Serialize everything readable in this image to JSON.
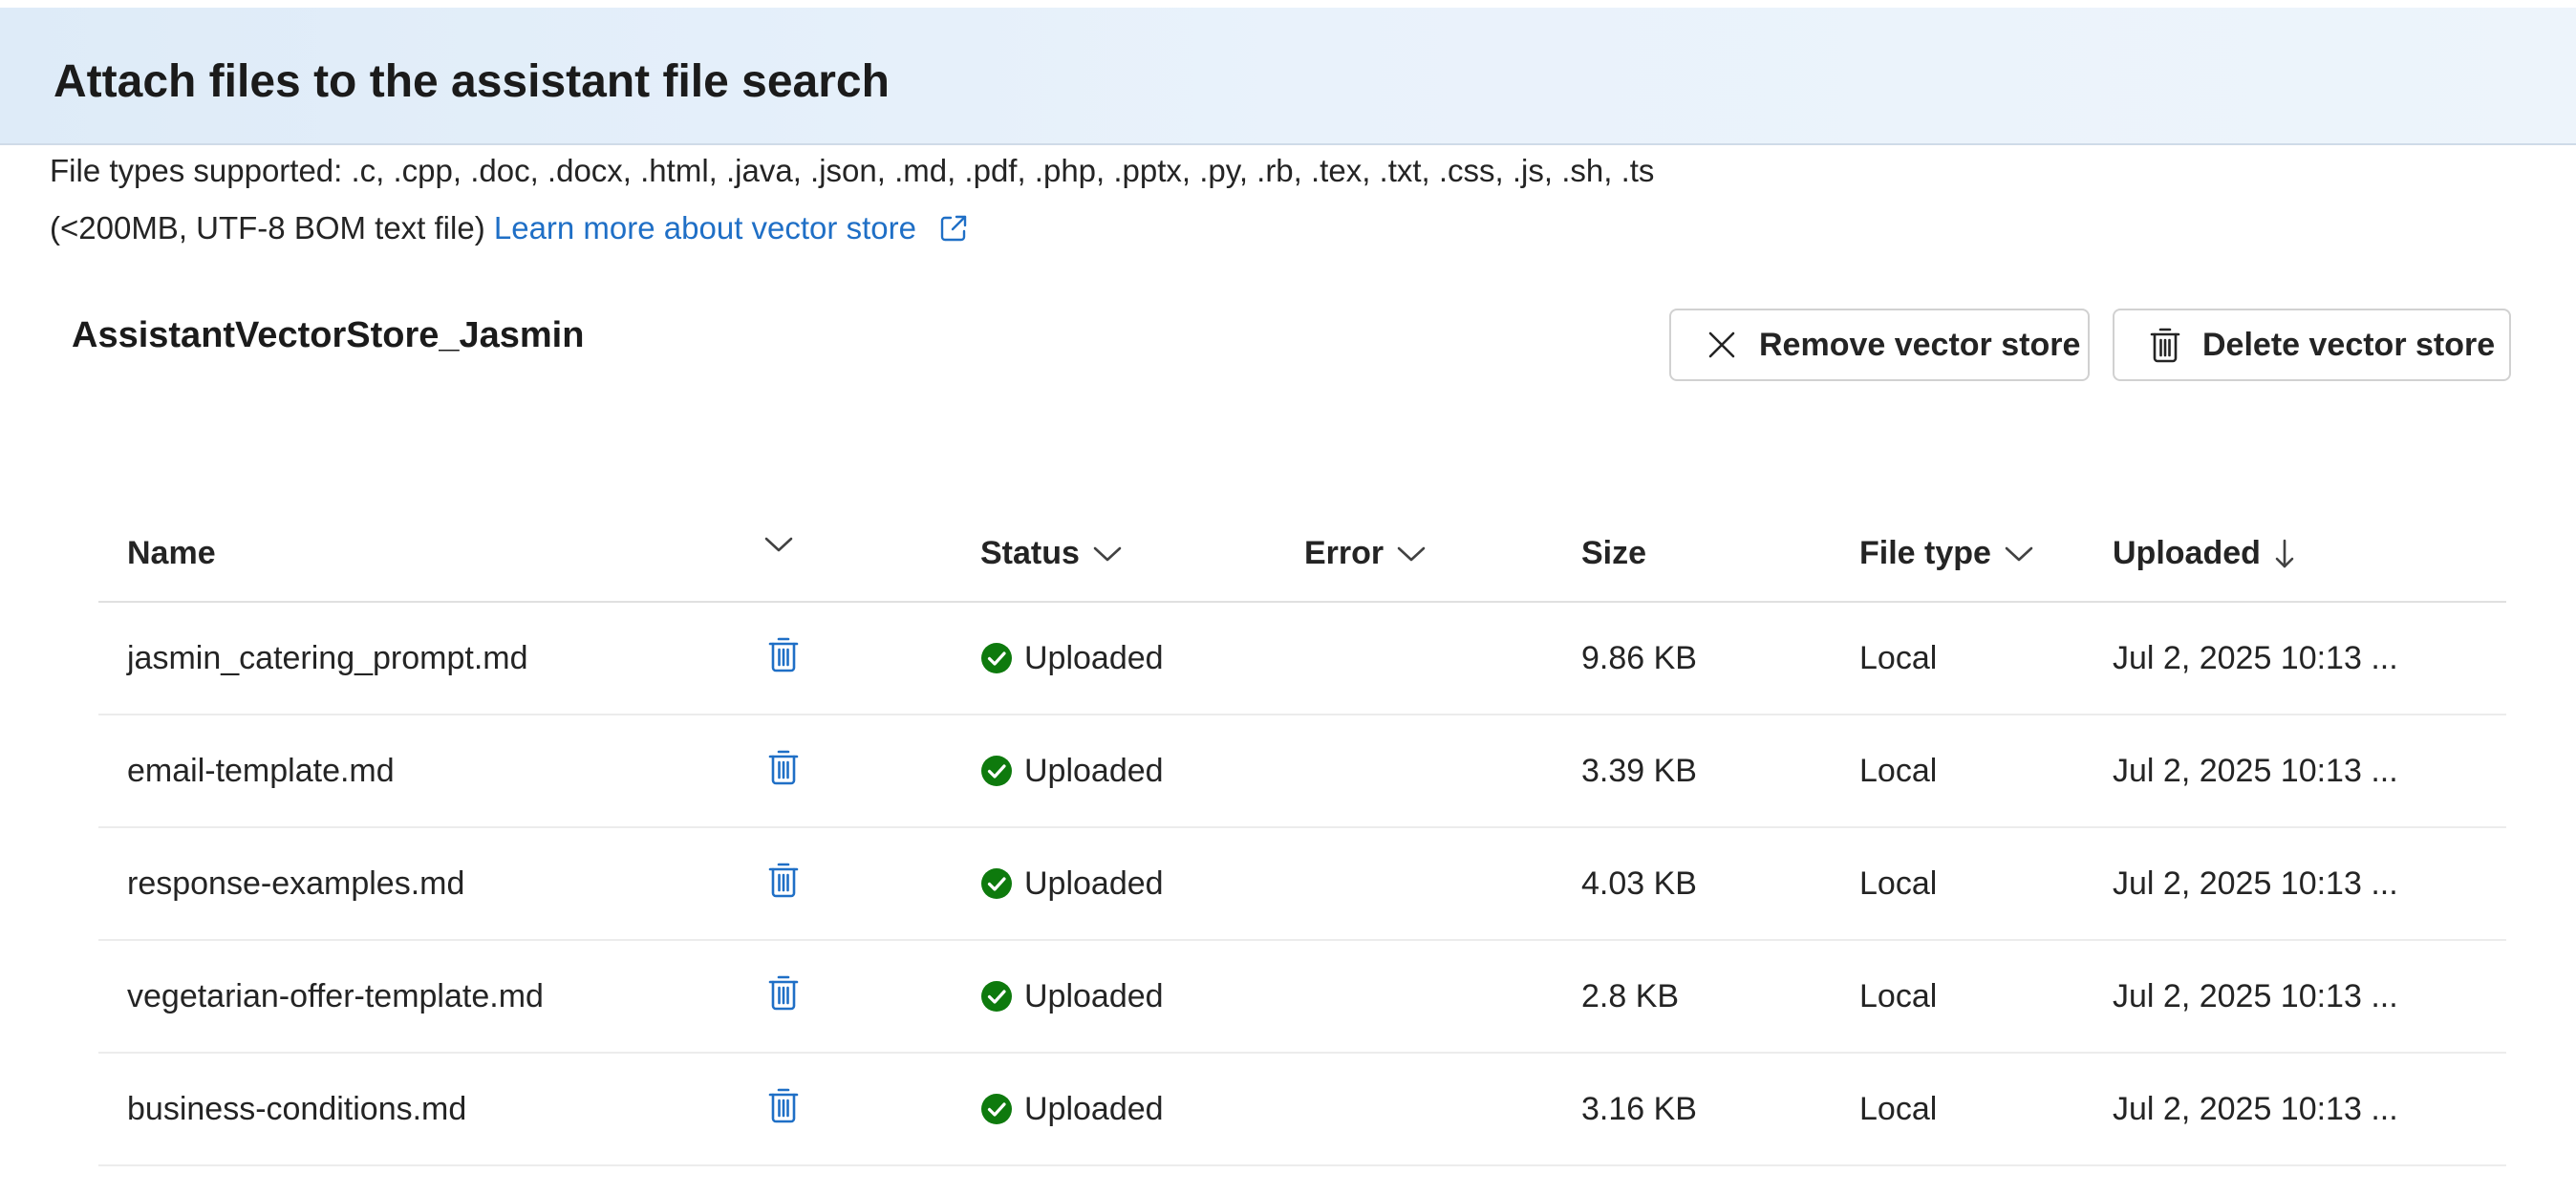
{
  "header": {
    "title": "Attach files to the assistant file search"
  },
  "description": {
    "file_types": "File types supported: .c, .cpp, .doc, .docx, .html, .java, .json, .md, .pdf, .php, .pptx, .py, .rb, .tex, .txt, .css, .js, .sh, .ts",
    "limits": "(<200MB, UTF-8 BOM text file)",
    "learn_more_link": "Learn more about vector store"
  },
  "vector_store": {
    "name": "AssistantVectorStore_Jasmin",
    "remove_button": "Remove vector store",
    "delete_button": "Delete vector store"
  },
  "table": {
    "columns": {
      "name": "Name",
      "status": "Status",
      "error": "Error",
      "size": "Size",
      "file_type": "File type",
      "uploaded": "Uploaded"
    },
    "sort": {
      "column": "uploaded",
      "direction": "descending"
    },
    "rows": [
      {
        "name": "jasmin_catering_prompt.md",
        "status": "Uploaded",
        "error": "",
        "size": "9.86 KB",
        "file_type": "Local",
        "uploaded": "Jul 2, 2025 10:13 ..."
      },
      {
        "name": "email-template.md",
        "status": "Uploaded",
        "error": "",
        "size": "3.39 KB",
        "file_type": "Local",
        "uploaded": "Jul 2, 2025 10:13 ..."
      },
      {
        "name": "response-examples.md",
        "status": "Uploaded",
        "error": "",
        "size": "4.03 KB",
        "file_type": "Local",
        "uploaded": "Jul 2, 2025 10:13 ..."
      },
      {
        "name": "vegetarian-offer-template.md",
        "status": "Uploaded",
        "error": "",
        "size": "2.8 KB",
        "file_type": "Local",
        "uploaded": "Jul 2, 2025 10:13 ..."
      },
      {
        "name": "business-conditions.md",
        "status": "Uploaded",
        "error": "",
        "size": "3.16 KB",
        "file_type": "Local",
        "uploaded": "Jul 2, 2025 10:13 ..."
      }
    ]
  },
  "colors": {
    "accent": "#1f6fc6",
    "success": "#0e7a0d",
    "header_bg": "#e3eefa"
  },
  "icons": {
    "external_link": "external-link-icon",
    "remove": "close-icon",
    "delete": "trash-icon",
    "column_menu": "chevron-down-icon",
    "sort": "arrow-down-icon",
    "status": "check-circle-icon"
  }
}
